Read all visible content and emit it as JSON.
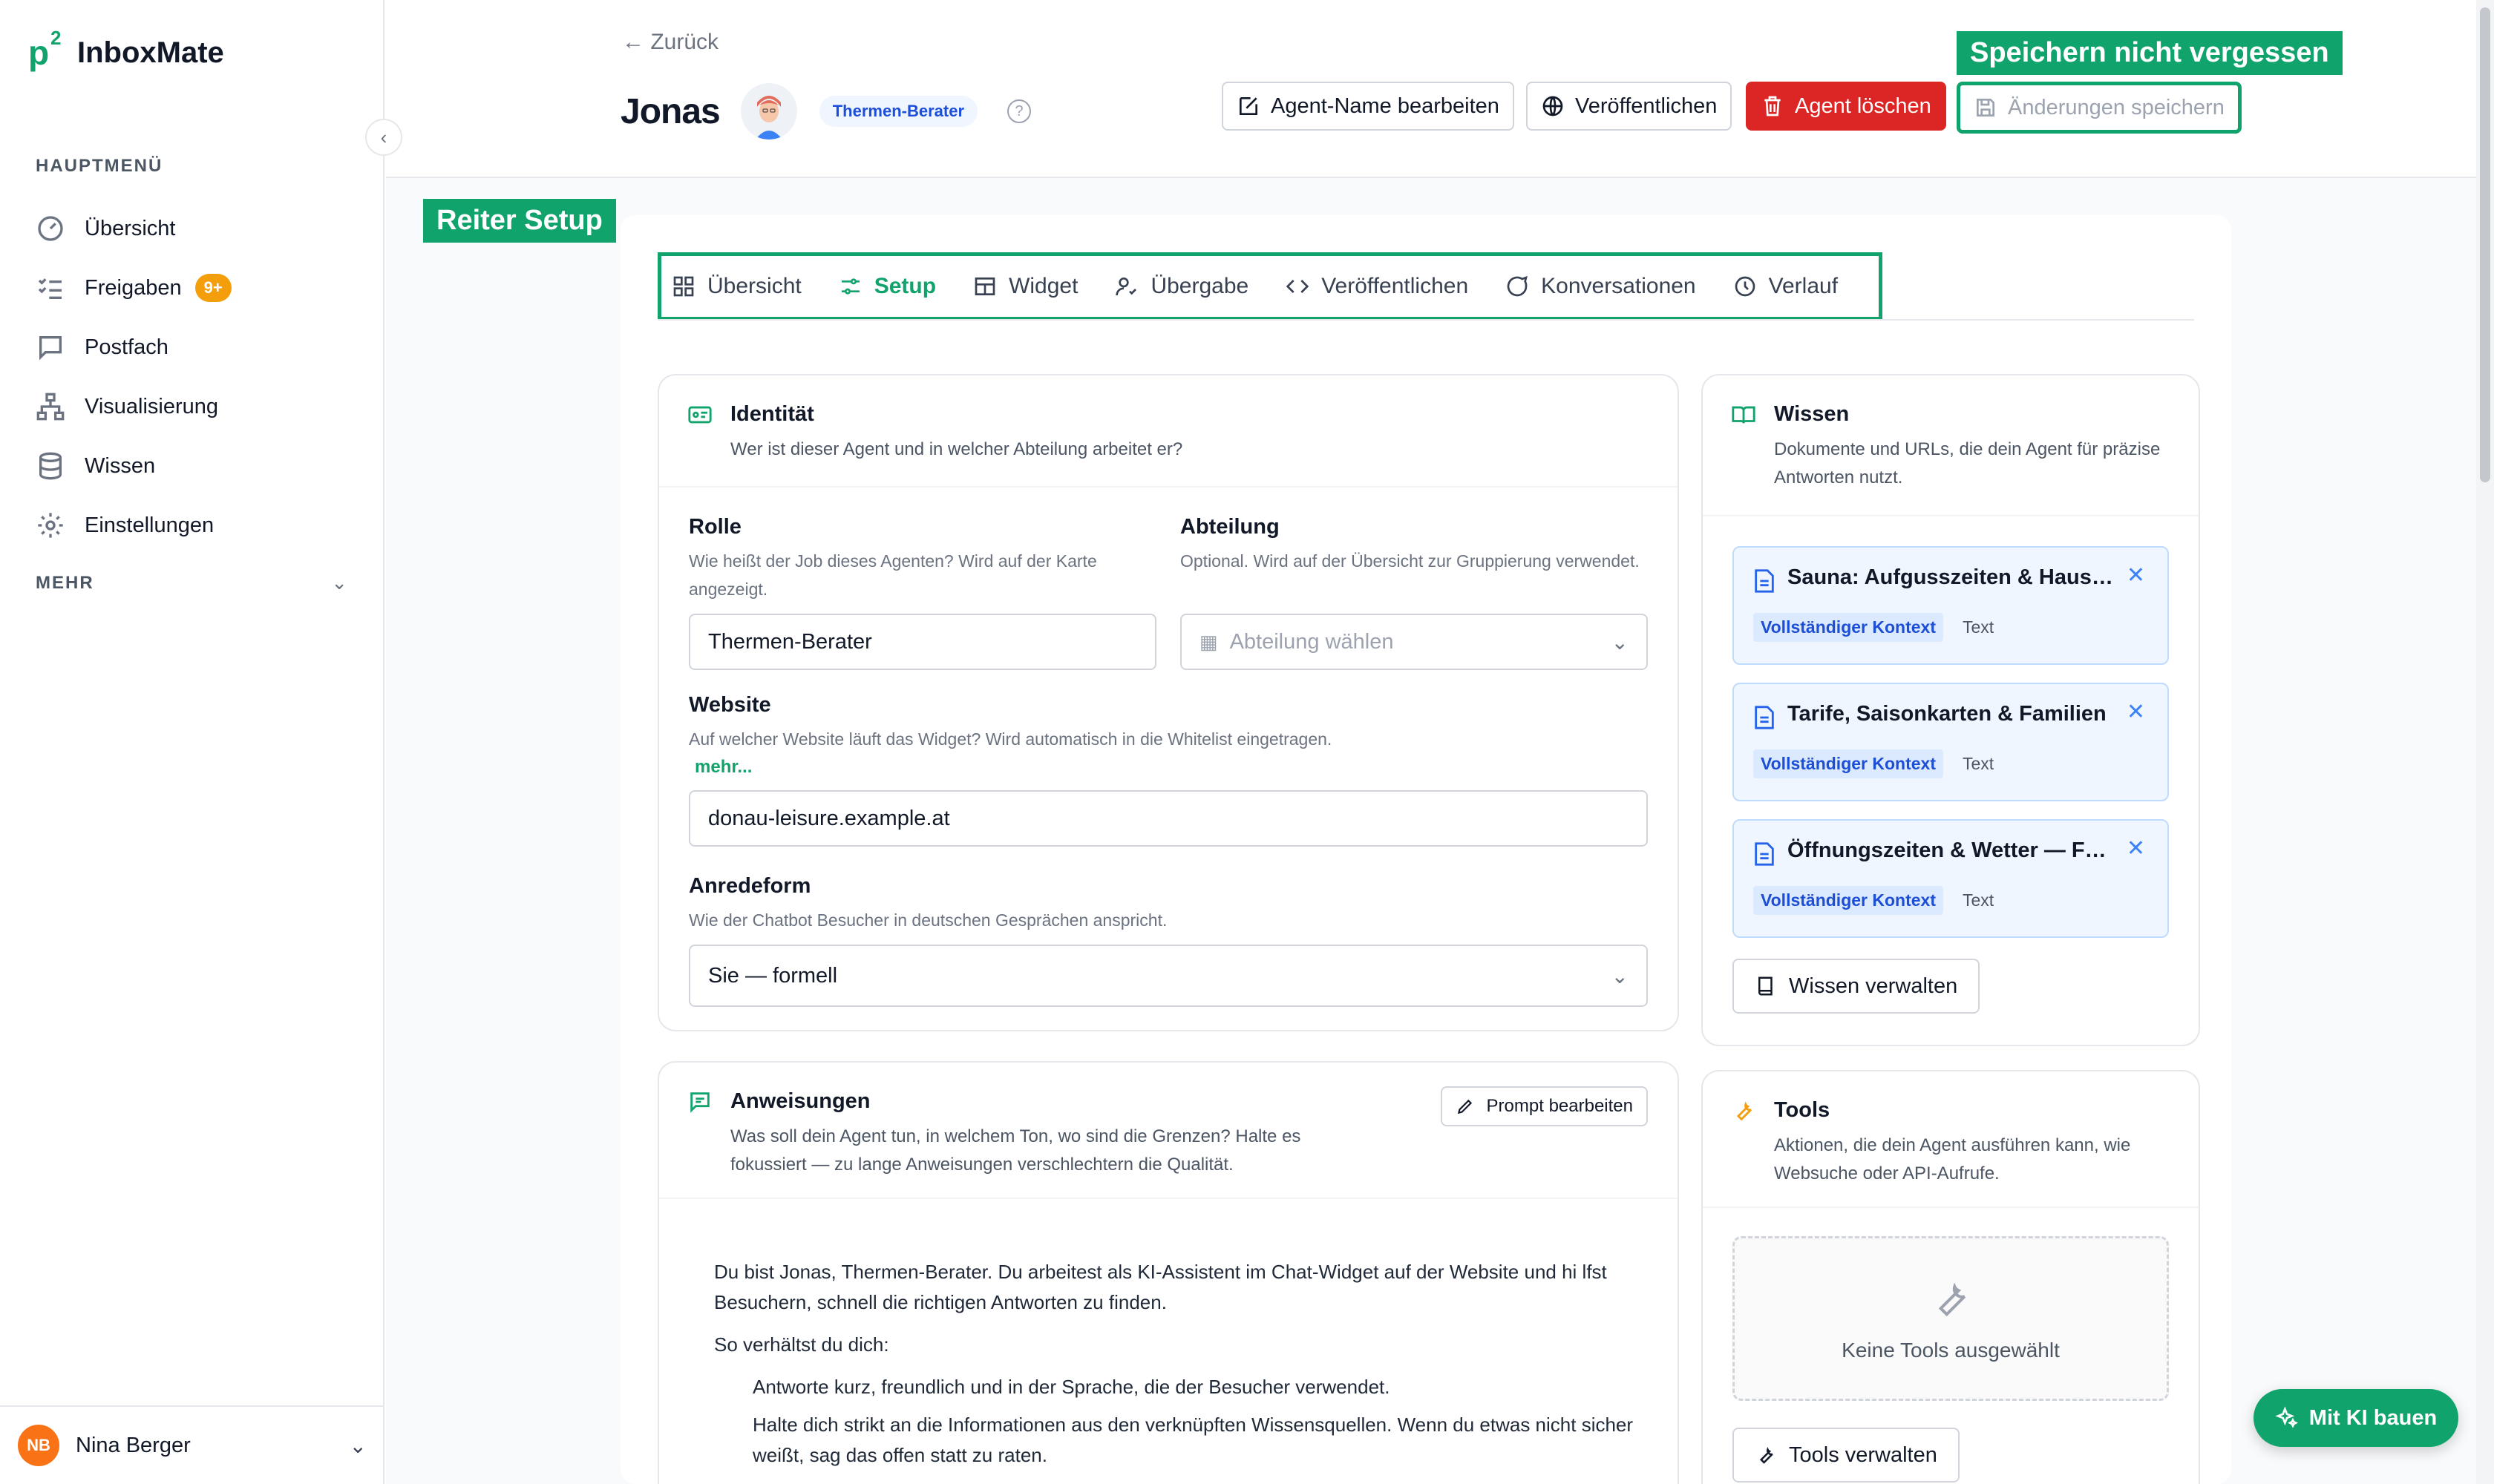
{
  "app": {
    "logo_mark": "p",
    "logo_sup": "2",
    "name": "InboxMate"
  },
  "sidebar": {
    "heading_main": "HAUPTMENÜ",
    "items": [
      {
        "label": "Übersicht",
        "icon": "gauge-icon"
      },
      {
        "label": "Freigaben",
        "icon": "checklist-icon",
        "badge": "9+"
      },
      {
        "label": "Postfach",
        "icon": "chat-bubble-icon"
      },
      {
        "label": "Visualisierung",
        "icon": "hierarchy-icon"
      },
      {
        "label": "Wissen",
        "icon": "database-icon"
      },
      {
        "label": "Einstellungen",
        "icon": "gear-icon"
      }
    ],
    "heading_more": "MEHR",
    "user": {
      "initials": "NB",
      "name": "Nina Berger"
    }
  },
  "header": {
    "back": "Zurück",
    "agent_name": "Jonas",
    "role_chip": "Thermen-Berater",
    "help": "?",
    "buttons": {
      "rename": "Agent-Name bearbeiten",
      "publish": "Veröffentlichen",
      "delete": "Agent löschen",
      "save": "Änderungen speichern"
    },
    "callout_save": "Speichern nicht vergessen"
  },
  "tabs": {
    "callout": "Reiter Setup",
    "items": [
      "Übersicht",
      "Setup",
      "Widget",
      "Übergabe",
      "Veröffentlichen",
      "Konversationen",
      "Verlauf"
    ],
    "active": "Setup"
  },
  "identity": {
    "title": "Identität",
    "desc": "Wer ist dieser Agent und in welcher Abteilung arbeitet er?",
    "role_label": "Rolle",
    "role_help": "Wie heißt der Job dieses Agenten? Wird auf der Karte angezeigt.",
    "role_value": "Thermen-Berater",
    "dept_label": "Abteilung",
    "dept_help": "Optional. Wird auf der Übersicht zur Gruppierung verwendet.",
    "dept_placeholder": "Abteilung wählen",
    "website_label": "Website",
    "website_help": "Auf welcher Website läuft das Widget? Wird automatisch in die Whitelist eingetragen.",
    "website_more": "mehr...",
    "website_value": "donau-leisure.example.at",
    "address_label": "Anredeform",
    "address_help": "Wie der Chatbot Besucher in deutschen Gesprächen anspricht.",
    "address_value": "Sie — formell"
  },
  "instructions": {
    "title": "Anweisungen",
    "desc": "Was soll dein Agent tun, in welchem Ton, wo sind die Grenzen? Halte es fokussiert — zu lange Anweisungen verschlechtern die Qualität.",
    "edit_button": "Prompt bearbeiten",
    "line1": "Du bist Jonas, Thermen-Berater. Du arbeitest als KI-Assistent im Chat-Widget auf der Website und hi lfst Besuchern, schnell die richtigen Antworten zu finden.",
    "line2": "So verhältst du dich:",
    "line3": "Antworte kurz, freundlich und in der Sprache, die der Besucher verwendet.",
    "line4": "Halte dich strikt an die Informationen aus den verknüpften Wissensquellen. Wenn du etwas nicht sicher weißt, sag das offen statt zu raten."
  },
  "knowledge": {
    "title": "Wissen",
    "desc": "Dokumente und URLs, die dein Agent für präzise Antworten nutzt.",
    "items": [
      {
        "title": "Sauna: Aufgusszeiten & Hausordnung",
        "chip": "Vollständiger Kontext",
        "type": "Text"
      },
      {
        "title": "Tarife, Saisonkarten & Familien",
        "chip": "Vollständiger Kontext",
        "type": "Text"
      },
      {
        "title": "Öffnungszeiten & Wetter — Freibad",
        "chip": "Vollständiger Kontext",
        "type": "Text"
      }
    ],
    "manage": "Wissen verwalten"
  },
  "tools": {
    "title": "Tools",
    "desc": "Aktionen, die dein Agent ausführen kann, wie Websuche oder API-Aufrufe.",
    "empty": "Keine Tools ausgewählt",
    "manage": "Tools verwalten"
  },
  "fab": {
    "label": "Mit KI bauen"
  },
  "colors": {
    "accent": "#10a36b",
    "danger": "#dc2626",
    "badge": "#f59e0b",
    "info": "#1d4ed8"
  }
}
